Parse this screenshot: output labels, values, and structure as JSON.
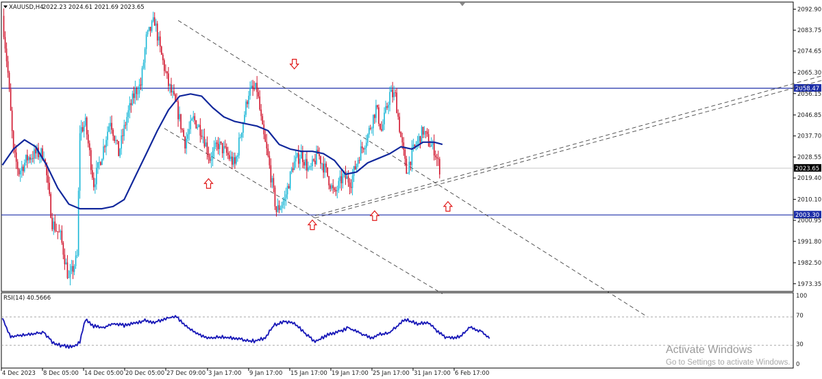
{
  "header": {
    "symbol": "XAUUSD,H4",
    "ohlc": "2022.23 2024.61 2021.69 2023.65"
  },
  "rsi_panel": {
    "label": "RSI(14) 40.5666",
    "levels": [
      "100",
      "70",
      "30",
      "0"
    ]
  },
  "watermark": {
    "title": "Activate Windows",
    "subtitle": "Go to Settings to activate Windows."
  },
  "colors": {
    "bull": "#17b6d6",
    "bear": "#d0132b",
    "ma": "#12289c",
    "hline": "#1c2ea8",
    "arrow": "#e01818",
    "trend": "#444444"
  },
  "chart_data": {
    "type": "candlestick",
    "price_axis_ticks": [
      "2092.90",
      "2083.75",
      "2074.65",
      "2065.30",
      "2056.15",
      "2046.85",
      "2037.70",
      "2028.55",
      "2019.40",
      "2010.10",
      "2000.95",
      "1991.80",
      "1982.50",
      "1973.35"
    ],
    "time_axis_ticks": [
      "4 Dec 2023",
      "8 Dec 05:00",
      "14 Dec 05:00",
      "20 Dec 05:00",
      "27 Dec 09:00",
      "3 Jan 17:00",
      "9 Jan 17:00",
      "15 Jan 17:00",
      "19 Jan 17:00",
      "25 Jan 17:00",
      "31 Jan 17:00",
      "6 Feb 17:00"
    ],
    "price_ylim": [
      1970,
      2096
    ],
    "horizontal_levels": [
      {
        "label": "2058.47",
        "price": 2058.47
      },
      {
        "label": "2003.30",
        "price": 2003.3
      }
    ],
    "current_price": {
      "label": "2023.65",
      "price": 2023.65
    },
    "anchors": [
      {
        "idx": 0,
        "price": 2090
      },
      {
        "idx": 4,
        "price": 2065
      },
      {
        "idx": 8,
        "price": 2030
      },
      {
        "idx": 12,
        "price": 2022
      },
      {
        "idx": 18,
        "price": 2028
      },
      {
        "idx": 24,
        "price": 2030
      },
      {
        "idx": 30,
        "price": 2030
      },
      {
        "idx": 36,
        "price": 2000
      },
      {
        "idx": 42,
        "price": 1994
      },
      {
        "idx": 48,
        "price": 1975
      },
      {
        "idx": 54,
        "price": 1985
      },
      {
        "idx": 56,
        "price": 2040
      },
      {
        "idx": 60,
        "price": 2043
      },
      {
        "idx": 66,
        "price": 2017
      },
      {
        "idx": 72,
        "price": 2030
      },
      {
        "idx": 78,
        "price": 2045
      },
      {
        "idx": 84,
        "price": 2030
      },
      {
        "idx": 90,
        "price": 2046
      },
      {
        "idx": 96,
        "price": 2057
      },
      {
        "idx": 100,
        "price": 2060
      },
      {
        "idx": 104,
        "price": 2080
      },
      {
        "idx": 110,
        "price": 2088
      },
      {
        "idx": 114,
        "price": 2075
      },
      {
        "idx": 120,
        "price": 2060
      },
      {
        "idx": 126,
        "price": 2050
      },
      {
        "idx": 132,
        "price": 2035
      },
      {
        "idx": 138,
        "price": 2045
      },
      {
        "idx": 144,
        "price": 2040
      },
      {
        "idx": 150,
        "price": 2028
      },
      {
        "idx": 156,
        "price": 2034
      },
      {
        "idx": 162,
        "price": 2030
      },
      {
        "idx": 168,
        "price": 2025
      },
      {
        "idx": 172,
        "price": 2038
      },
      {
        "idx": 178,
        "price": 2057
      },
      {
        "idx": 184,
        "price": 2058
      },
      {
        "idx": 188,
        "price": 2040
      },
      {
        "idx": 192,
        "price": 2028
      },
      {
        "idx": 198,
        "price": 2005
      },
      {
        "idx": 204,
        "price": 2010
      },
      {
        "idx": 210,
        "price": 2025
      },
      {
        "idx": 216,
        "price": 2030
      },
      {
        "idx": 222,
        "price": 2022
      },
      {
        "idx": 228,
        "price": 2030
      },
      {
        "idx": 234,
        "price": 2022
      },
      {
        "idx": 240,
        "price": 2012
      },
      {
        "idx": 246,
        "price": 2020
      },
      {
        "idx": 252,
        "price": 2018
      },
      {
        "idx": 258,
        "price": 2030
      },
      {
        "idx": 264,
        "price": 2038
      },
      {
        "idx": 270,
        "price": 2050
      },
      {
        "idx": 274,
        "price": 2040
      },
      {
        "idx": 280,
        "price": 2056
      },
      {
        "idx": 284,
        "price": 2055
      },
      {
        "idx": 288,
        "price": 2037
      },
      {
        "idx": 292,
        "price": 2022
      },
      {
        "idx": 296,
        "price": 2030
      },
      {
        "idx": 300,
        "price": 2035
      },
      {
        "idx": 304,
        "price": 2040
      },
      {
        "idx": 308,
        "price": 2035
      },
      {
        "idx": 312,
        "price": 2032
      },
      {
        "idx": 316,
        "price": 2023.65
      }
    ],
    "ma_series": [
      {
        "idx": 0,
        "price": 2025
      },
      {
        "idx": 8,
        "price": 2032
      },
      {
        "idx": 16,
        "price": 2036
      },
      {
        "idx": 24,
        "price": 2033
      },
      {
        "idx": 32,
        "price": 2025
      },
      {
        "idx": 40,
        "price": 2015
      },
      {
        "idx": 48,
        "price": 2008
      },
      {
        "idx": 56,
        "price": 2006
      },
      {
        "idx": 64,
        "price": 2006
      },
      {
        "idx": 72,
        "price": 2006
      },
      {
        "idx": 80,
        "price": 2007
      },
      {
        "idx": 88,
        "price": 2010
      },
      {
        "idx": 96,
        "price": 2020
      },
      {
        "idx": 104,
        "price": 2030
      },
      {
        "idx": 112,
        "price": 2040
      },
      {
        "idx": 120,
        "price": 2049
      },
      {
        "idx": 128,
        "price": 2055
      },
      {
        "idx": 136,
        "price": 2056
      },
      {
        "idx": 144,
        "price": 2055
      },
      {
        "idx": 152,
        "price": 2050
      },
      {
        "idx": 160,
        "price": 2046
      },
      {
        "idx": 168,
        "price": 2044
      },
      {
        "idx": 176,
        "price": 2043
      },
      {
        "idx": 184,
        "price": 2042
      },
      {
        "idx": 192,
        "price": 2040
      },
      {
        "idx": 200,
        "price": 2034
      },
      {
        "idx": 208,
        "price": 2032
      },
      {
        "idx": 216,
        "price": 2031
      },
      {
        "idx": 224,
        "price": 2031
      },
      {
        "idx": 232,
        "price": 2030
      },
      {
        "idx": 240,
        "price": 2027
      },
      {
        "idx": 248,
        "price": 2021
      },
      {
        "idx": 256,
        "price": 2022
      },
      {
        "idx": 264,
        "price": 2026
      },
      {
        "idx": 272,
        "price": 2028
      },
      {
        "idx": 280,
        "price": 2030
      },
      {
        "idx": 288,
        "price": 2033
      },
      {
        "idx": 296,
        "price": 2032
      },
      {
        "idx": 304,
        "price": 2035
      },
      {
        "idx": 312,
        "price": 2035
      },
      {
        "idx": 318,
        "price": 2034
      }
    ],
    "trendlines": [
      {
        "from": {
          "idx": 127,
          "price": 2088
        },
        "to": {
          "idx": 466,
          "price": 1959
        }
      },
      {
        "from": {
          "idx": 117,
          "price": 2041
        },
        "to": {
          "idx": 318,
          "price": 1969
        }
      },
      {
        "from": {
          "idx": 226,
          "price": 2003
        },
        "to": {
          "idx": 593,
          "price": 2064
        }
      },
      {
        "from": {
          "idx": 226,
          "price": 2002
        },
        "to": {
          "idx": 593,
          "price": 2062
        }
      }
    ],
    "arrows": [
      {
        "dir": "down",
        "idx": 211,
        "price": 2069
      },
      {
        "dir": "up",
        "idx": 149,
        "price": 2017
      },
      {
        "dir": "up",
        "idx": 224,
        "price": 1999
      },
      {
        "dir": "up",
        "idx": 269,
        "price": 2003
      },
      {
        "dir": "up",
        "idx": 322,
        "price": 2007
      }
    ],
    "rsi": {
      "ylim": [
        0,
        100
      ],
      "levels": [
        70,
        30
      ],
      "anchors": [
        {
          "idx": 0,
          "value": 68
        },
        {
          "idx": 6,
          "value": 42
        },
        {
          "idx": 14,
          "value": 44
        },
        {
          "idx": 22,
          "value": 46
        },
        {
          "idx": 30,
          "value": 48
        },
        {
          "idx": 36,
          "value": 35
        },
        {
          "idx": 42,
          "value": 30
        },
        {
          "idx": 50,
          "value": 28
        },
        {
          "idx": 56,
          "value": 34
        },
        {
          "idx": 60,
          "value": 67
        },
        {
          "idx": 66,
          "value": 57
        },
        {
          "idx": 72,
          "value": 55
        },
        {
          "idx": 80,
          "value": 60
        },
        {
          "idx": 88,
          "value": 58
        },
        {
          "idx": 96,
          "value": 62
        },
        {
          "idx": 104,
          "value": 65
        },
        {
          "idx": 110,
          "value": 62
        },
        {
          "idx": 118,
          "value": 68
        },
        {
          "idx": 126,
          "value": 70
        },
        {
          "idx": 134,
          "value": 55
        },
        {
          "idx": 142,
          "value": 45
        },
        {
          "idx": 150,
          "value": 40
        },
        {
          "idx": 158,
          "value": 42
        },
        {
          "idx": 166,
          "value": 40
        },
        {
          "idx": 174,
          "value": 38
        },
        {
          "idx": 182,
          "value": 36
        },
        {
          "idx": 190,
          "value": 40
        },
        {
          "idx": 196,
          "value": 58
        },
        {
          "idx": 204,
          "value": 64
        },
        {
          "idx": 212,
          "value": 60
        },
        {
          "idx": 218,
          "value": 48
        },
        {
          "idx": 226,
          "value": 35
        },
        {
          "idx": 234,
          "value": 44
        },
        {
          "idx": 242,
          "value": 48
        },
        {
          "idx": 250,
          "value": 55
        },
        {
          "idx": 258,
          "value": 48
        },
        {
          "idx": 266,
          "value": 40
        },
        {
          "idx": 272,
          "value": 45
        },
        {
          "idx": 280,
          "value": 48
        },
        {
          "idx": 288,
          "value": 62
        },
        {
          "idx": 292,
          "value": 66
        },
        {
          "idx": 300,
          "value": 60
        },
        {
          "idx": 308,
          "value": 62
        },
        {
          "idx": 314,
          "value": 50
        },
        {
          "idx": 320,
          "value": 42
        },
        {
          "idx": 326,
          "value": 40
        },
        {
          "idx": 332,
          "value": 44
        },
        {
          "idx": 338,
          "value": 55
        },
        {
          "idx": 346,
          "value": 50
        },
        {
          "idx": 352,
          "value": 40.5666
        }
      ]
    }
  }
}
